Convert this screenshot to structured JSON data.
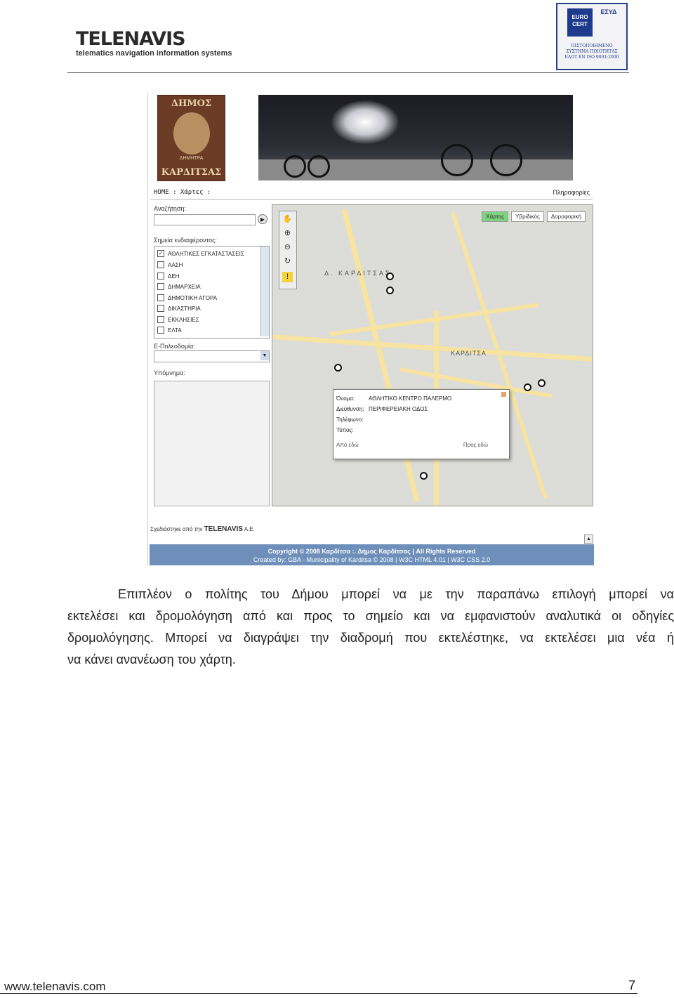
{
  "header": {
    "logo_word": "TELENAVIS",
    "logo_tagline": "telematics navigation information systems",
    "cert_euro": "EURO CERT",
    "cert_esyd": "ΕΣΥΔ",
    "cert_text": "ΠΙΣΤΟΠΟΙΗΜΕΝΟ ΣΥΣΤΗΜΑ ΠΟΙΟΤΗΤΑΣ ΕΛΟΤ ΕΝ ISO 9001:2000"
  },
  "screenshot": {
    "seal_top": "ΔΗΜΟΣ",
    "seal_mid": "ΔΗΜΗΤΡΑ",
    "seal_bottom": "ΚΑΡΔΙΤΣΑΣ",
    "nav_home": "HOME : Χάρτες :",
    "nav_info": "Πληροφορίες",
    "search_label": "Αναζήτηση:",
    "poi_label": "Σημεία ενδιαφέροντος:",
    "poi_items": [
      {
        "label": "ΑΘΛΗΤΙΚΕΣ ΕΓΚΑΤΑΣΤΑΣΕΙΣ",
        "checked": true
      },
      {
        "label": "ΑΑΣΗ",
        "checked": false
      },
      {
        "label": "ΔΕΗ",
        "checked": false
      },
      {
        "label": "ΔΗΜΑΡΧΕΙΑ",
        "checked": false
      },
      {
        "label": "ΔΗΜΟΤΙΚΗ ΑΓΟΡΑ",
        "checked": false
      },
      {
        "label": "ΔΙΚΑΣΤΗΡΙΑ",
        "checked": false
      },
      {
        "label": "ΕΚΚΛΗΣΙΕΣ",
        "checked": false
      },
      {
        "label": "ΕΛΤΑ",
        "checked": false
      }
    ],
    "epolodomia_label": "Ε-Πολεοδομία:",
    "legend_label": "Υπόμνημα:",
    "map_tabs": [
      "Χάρτης",
      "Υβριδικός",
      "Δορυφορική"
    ],
    "map_city_label": "Δ. ΚΑΡΔΙΤΣΑΣ",
    "map_center_label": "ΚΑΡΔΙΤΣΑ",
    "popup": {
      "name_label": "Όνομα:",
      "name_value": "ΑΘΛΗΤΙΚΟ ΚΕΝΤΡΟ ΠΑΛΕΡΜΟ",
      "address_label": "Διεύθυνση:",
      "address_value": "ΠΕΡΙΦΕΡΕΙΑΚΗ ΟΔΟΣ",
      "phone_label": "Τηλέφωνο:",
      "type_label": "Τύπος:",
      "from_here": "Από εδώ",
      "to_here": "Προς εδώ"
    },
    "credit_prefix": "Σχεδιάστηκε από την",
    "credit_logo": "TELENAVIS",
    "credit_suffix": "A.E.",
    "copyright": "Copyright © 2008 Καρδίτσα :. Δήμος Καρδίτσας | All Rights Reserved",
    "created_by": "Created by:",
    "gba": "GBA",
    "created_mid": "- Municipality of Karditsa © 2008 |",
    "w3c_html": "W3C HTML 4.01",
    "w3c_css": "W3C CSS 2.0"
  },
  "body": {
    "lines": [
      "Επιπλέον ο πολίτης του Δήμου μπορεί να με την παραπάνω επιλογή μπορεί να",
      "εκτελέσει και δρομολόγηση από και προς το σημείο και να εμφανιστούν αναλυτικά οι οδηγίες",
      "δρομολόγησης. Μπορεί να διαγράψει την διαδρομή που εκτελέστηκε, να εκτελέσει μια νέα ή",
      "να κάνει ανανέωση του χάρτη."
    ]
  },
  "footer": {
    "url": "www.telenavis.com",
    "page_number": "7"
  }
}
